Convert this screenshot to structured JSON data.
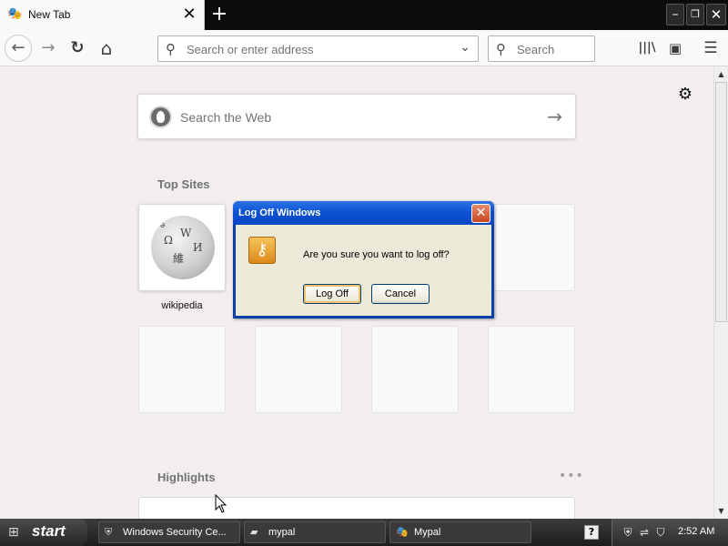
{
  "browser": {
    "tab": {
      "title": "New Tab",
      "icon": "mask-icon",
      "close_glyph": "✕"
    },
    "new_tab_glyph": "+",
    "window_controls": {
      "minimize": "–",
      "restore": "❐",
      "close": "✕"
    },
    "nav": {
      "back_glyph": "←",
      "forward_glyph": "→",
      "reload_glyph": "↻",
      "home_glyph": "⌂",
      "url_placeholder": "Search or enter address",
      "search_placeholder": "Search",
      "library_glyph": "|||\\",
      "sidebar_glyph": "▣",
      "menu_glyph": "☰"
    }
  },
  "newtab": {
    "settings_glyph": "⚙",
    "web_search_placeholder": "Search the Web",
    "web_search_go": "→",
    "top_sites_title": "Top Sites",
    "top_sites": [
      {
        "label": "wikipedia",
        "icon": "wikipedia-globe-icon"
      }
    ],
    "highlights_title": "Highlights",
    "highlights_menu_glyph": "•••"
  },
  "dialog": {
    "title": "Log Off Windows",
    "close_glyph": "✕",
    "message": "Are you sure you want to log off?",
    "icon": "key-icon",
    "primary_button": "Log Off",
    "secondary_button": "Cancel"
  },
  "taskbar": {
    "start_label": "start",
    "tasks": [
      {
        "label": "Windows Security Ce...",
        "icon": "shield-icon"
      },
      {
        "label": "mypal",
        "icon": "folder-icon"
      },
      {
        "label": "Mypal",
        "icon": "mask-icon"
      }
    ],
    "help_glyph": "?",
    "clock": "2:52 AM"
  },
  "colors": {
    "page_bg": "#f2eeee",
    "dialog_title": "#0b50d2",
    "taskbar": "#2a2a2a"
  }
}
